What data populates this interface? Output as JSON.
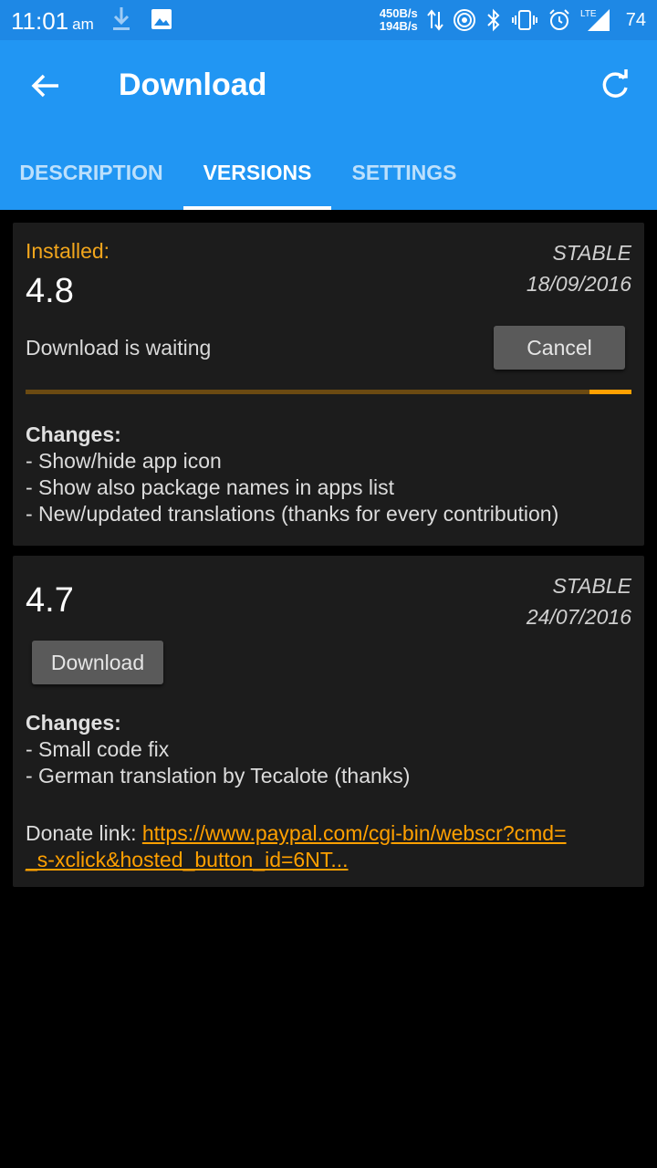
{
  "status": {
    "time": "11:01",
    "ampm": "am",
    "net_up": "450B/s",
    "net_down": "194B/s",
    "network": "LTE",
    "battery": "74"
  },
  "appbar": {
    "title": "Download"
  },
  "tabs": [
    {
      "label": "DESCRIPTION"
    },
    {
      "label": "VERSIONS",
      "active": true
    },
    {
      "label": "SETTINGS"
    }
  ],
  "versions": [
    {
      "installed_label": "Installed:",
      "version": "4.8",
      "channel": "STABLE",
      "date": "18/09/2016",
      "status_text": "Download is waiting",
      "button_label": "Cancel",
      "progress": 0.07,
      "changes_title": "Changes:",
      "changes": [
        "- Show/hide app icon",
        "- Show also package names in apps list",
        "- New/updated translations (thanks for every contribution)"
      ]
    },
    {
      "version": "4.7",
      "channel": "STABLE",
      "date": "24/07/2016",
      "button_label": "Download",
      "changes_title": "Changes:",
      "changes": [
        "- Small code fix",
        "- German translation by Tecalote (thanks)"
      ],
      "donate_label": "Donate link:",
      "donate_url_line1": "https://www.paypal.com/cgi-bin/webscr?cmd=",
      "donate_url_line2": "_s-xclick&hosted_button_id=6NT..."
    }
  ],
  "colors": {
    "statusbar": "#1E88E5",
    "appbar": "#2196F3",
    "accent": "#FFA000",
    "installed": "#F2A61C",
    "card": "#1c1c1c"
  }
}
